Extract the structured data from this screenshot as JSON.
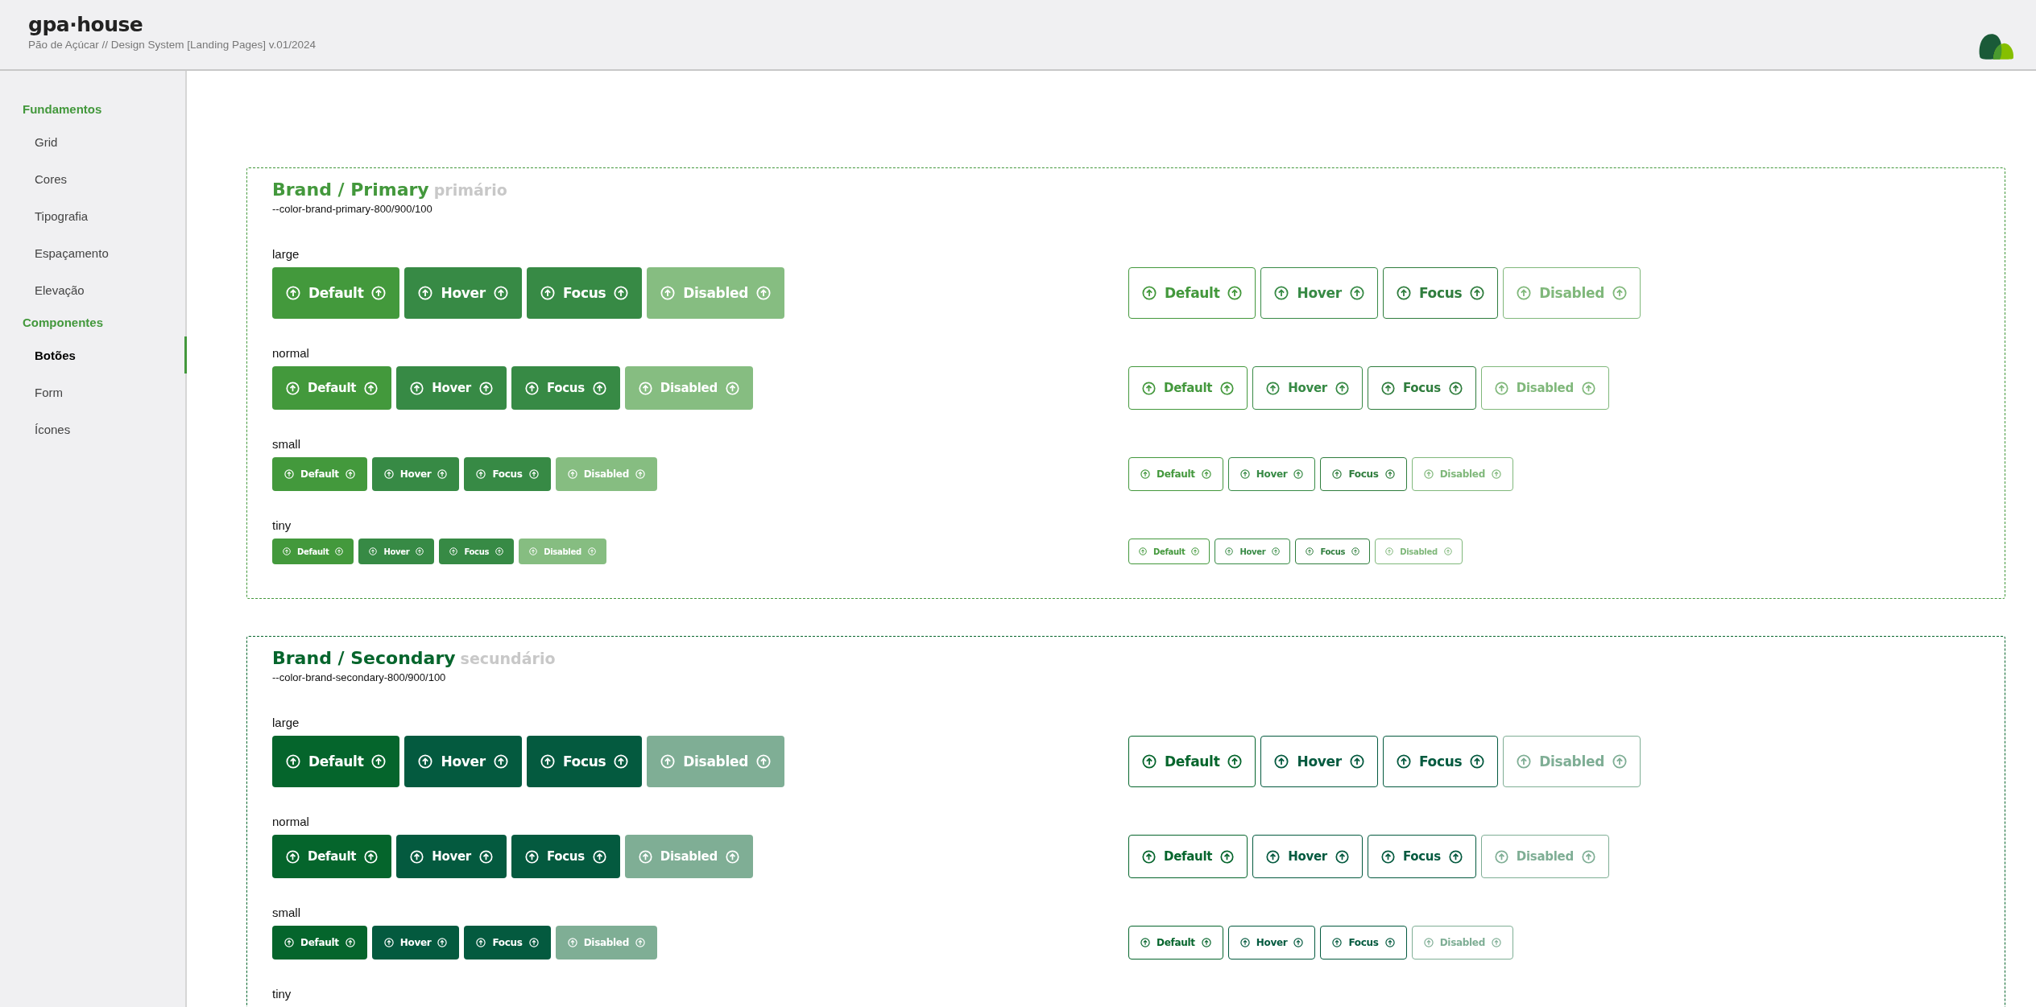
{
  "header": {
    "brand": "gpa·house",
    "subtitle": "Pão de Açúcar // Design System [Landing Pages] v.01/2024"
  },
  "sidebar": {
    "groups": [
      {
        "title": "Fundamentos",
        "items": [
          {
            "label": "Grid",
            "selected": false
          },
          {
            "label": "Cores",
            "selected": false
          },
          {
            "label": "Tipografia",
            "selected": false
          },
          {
            "label": "Espaçamento",
            "selected": false
          },
          {
            "label": "Elevação",
            "selected": false
          }
        ]
      },
      {
        "title": "Componentes",
        "items": [
          {
            "label": "Botões",
            "selected": true
          },
          {
            "label": "Form",
            "selected": false
          },
          {
            "label": "Ícones",
            "selected": false
          }
        ]
      }
    ]
  },
  "sections": [
    {
      "kind": "primary",
      "title": "Brand / Primary",
      "subtitle": "primário",
      "token": "--color-brand-primary-800/900/100",
      "rows": [
        {
          "size": "large",
          "filled": [
            {
              "label": "Default",
              "kind": "default"
            },
            {
              "label": "Hover",
              "kind": "hover"
            },
            {
              "label": "Focus",
              "kind": "focus"
            },
            {
              "label": "Disabled",
              "kind": "disabled"
            }
          ],
          "outline": [
            {
              "label": "Default",
              "kind": "default"
            },
            {
              "label": "Hover",
              "kind": "hover"
            },
            {
              "label": "Focus",
              "kind": "focus"
            },
            {
              "label": "Disabled",
              "kind": "disabled"
            }
          ]
        },
        {
          "size": "normal",
          "filled": [
            {
              "label": "Default",
              "kind": "default"
            },
            {
              "label": "Hover",
              "kind": "hover"
            },
            {
              "label": "Focus",
              "kind": "focus"
            },
            {
              "label": "Disabled",
              "kind": "disabled"
            }
          ],
          "outline": [
            {
              "label": "Default",
              "kind": "default"
            },
            {
              "label": "Hover",
              "kind": "hover"
            },
            {
              "label": "Focus",
              "kind": "focus"
            },
            {
              "label": "Disabled",
              "kind": "disabled"
            }
          ]
        },
        {
          "size": "small",
          "filled": [
            {
              "label": "Default",
              "kind": "default"
            },
            {
              "label": "Hover",
              "kind": "hover"
            },
            {
              "label": "Focus",
              "kind": "focus"
            },
            {
              "label": "Disabled",
              "kind": "disabled"
            }
          ],
          "outline": [
            {
              "label": "Default",
              "kind": "default"
            },
            {
              "label": "Hover",
              "kind": "hover"
            },
            {
              "label": "Focus",
              "kind": "focus"
            },
            {
              "label": "Disabled",
              "kind": "disabled"
            }
          ]
        },
        {
          "size": "tiny",
          "filled": [
            {
              "label": "Default",
              "kind": "default"
            },
            {
              "label": "Hover",
              "kind": "hover"
            },
            {
              "label": "Focus",
              "kind": "focus"
            },
            {
              "label": "Disabled",
              "kind": "disabled"
            }
          ],
          "outline": [
            {
              "label": "Default",
              "kind": "default"
            },
            {
              "label": "Hover",
              "kind": "hover"
            },
            {
              "label": "Focus",
              "kind": "focus"
            },
            {
              "label": "Disabled",
              "kind": "disabled"
            }
          ]
        }
      ]
    },
    {
      "kind": "secondary",
      "title": "Brand / Secondary",
      "subtitle": "secundário",
      "token": "--color-brand-secondary-800/900/100",
      "rows": [
        {
          "size": "large",
          "filled": [
            {
              "label": "Default",
              "kind": "default"
            },
            {
              "label": "Hover",
              "kind": "hover"
            },
            {
              "label": "Focus",
              "kind": "focus"
            },
            {
              "label": "Disabled",
              "kind": "disabled"
            }
          ],
          "outline": [
            {
              "label": "Default",
              "kind": "default"
            },
            {
              "label": "Hover",
              "kind": "hover"
            },
            {
              "label": "Focus",
              "kind": "focus"
            },
            {
              "label": "Disabled",
              "kind": "disabled"
            }
          ]
        },
        {
          "size": "normal",
          "filled": [
            {
              "label": "Default",
              "kind": "default"
            },
            {
              "label": "Hover",
              "kind": "hover"
            },
            {
              "label": "Focus",
              "kind": "focus"
            },
            {
              "label": "Disabled",
              "kind": "disabled"
            }
          ],
          "outline": [
            {
              "label": "Default",
              "kind": "default"
            },
            {
              "label": "Hover",
              "kind": "hover"
            },
            {
              "label": "Focus",
              "kind": "focus"
            },
            {
              "label": "Disabled",
              "kind": "disabled"
            }
          ]
        },
        {
          "size": "small",
          "filled": [
            {
              "label": "Default",
              "kind": "default"
            },
            {
              "label": "Hover",
              "kind": "hover"
            },
            {
              "label": "Focus",
              "kind": "focus"
            },
            {
              "label": "Disabled",
              "kind": "disabled"
            }
          ],
          "outline": [
            {
              "label": "Default",
              "kind": "default"
            },
            {
              "label": "Hover",
              "kind": "hover"
            },
            {
              "label": "Focus",
              "kind": "focus"
            },
            {
              "label": "Disabled",
              "kind": "disabled"
            }
          ]
        },
        {
          "size": "tiny"
        }
      ]
    }
  ]
}
